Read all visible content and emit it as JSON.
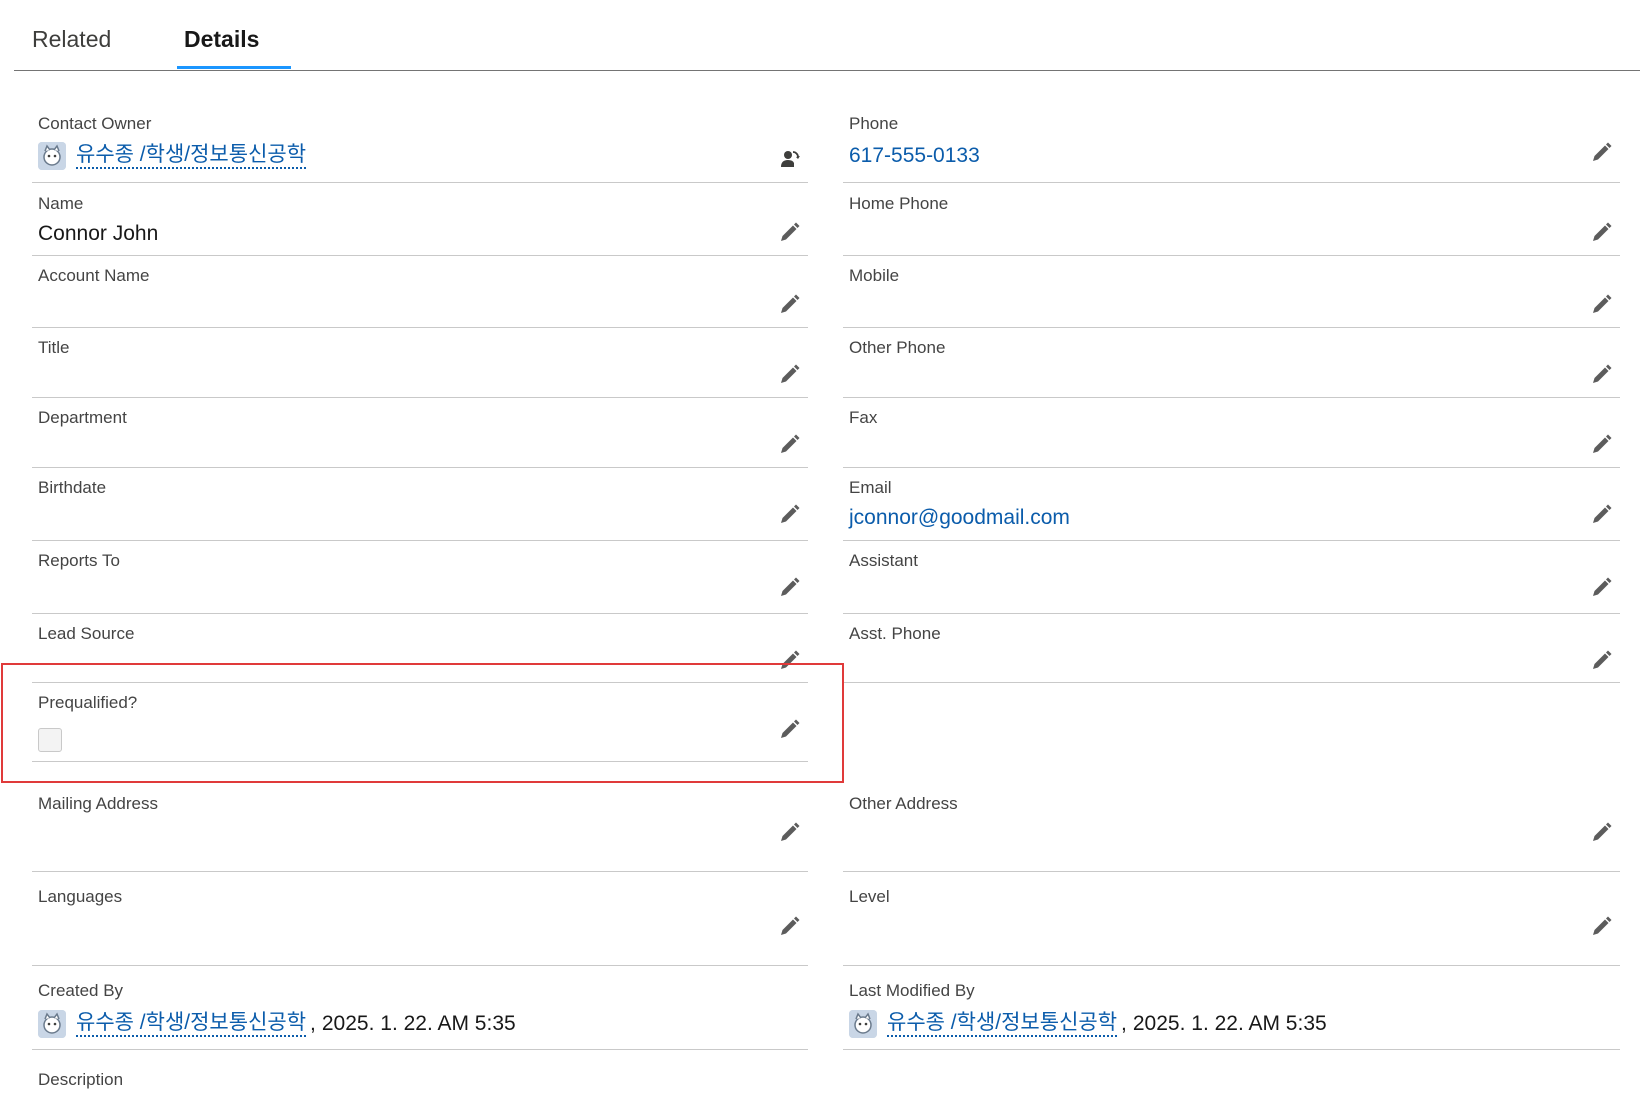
{
  "tabs": {
    "related": "Related",
    "details": "Details"
  },
  "owner": {
    "label": "Contact Owner",
    "name": "유수종 /학생/정보통신공학"
  },
  "left_fields": {
    "name": {
      "label": "Name",
      "value": "Connor John"
    },
    "account": {
      "label": "Account Name",
      "value": ""
    },
    "title": {
      "label": "Title",
      "value": ""
    },
    "department": {
      "label": "Department",
      "value": ""
    },
    "birthdate": {
      "label": "Birthdate",
      "value": ""
    },
    "reports_to": {
      "label": "Reports To",
      "value": ""
    },
    "lead_source": {
      "label": "Lead Source",
      "value": ""
    },
    "prequalified": {
      "label": "Prequalified?",
      "checked": false
    },
    "mailing_address": {
      "label": "Mailing Address",
      "value": ""
    },
    "languages": {
      "label": "Languages",
      "value": ""
    }
  },
  "right_fields": {
    "phone": {
      "label": "Phone",
      "value": "617-555-0133"
    },
    "home_phone": {
      "label": "Home Phone",
      "value": ""
    },
    "mobile": {
      "label": "Mobile",
      "value": ""
    },
    "other_phone": {
      "label": "Other Phone",
      "value": ""
    },
    "fax": {
      "label": "Fax",
      "value": ""
    },
    "email": {
      "label": "Email",
      "value": "jconnor@goodmail.com"
    },
    "assistant": {
      "label": "Assistant",
      "value": ""
    },
    "asst_phone": {
      "label": "Asst. Phone",
      "value": ""
    },
    "other_address": {
      "label": "Other Address",
      "value": ""
    },
    "level": {
      "label": "Level",
      "value": ""
    }
  },
  "created": {
    "label": "Created By",
    "name": "유수종 /학생/정보통신공학",
    "sep": ",",
    "date": "2025. 1. 22. AM 5:35"
  },
  "modified": {
    "label": "Last Modified By",
    "name": "유수종 /학생/정보통신공학",
    "sep": ",",
    "date": "2025. 1. 22. AM 5:35"
  },
  "description": {
    "label": "Description"
  },
  "colors": {
    "link": "#0b5cab",
    "tab_accent": "#1b96ff",
    "highlight": "#e03a3a"
  },
  "icons": {
    "edit": "pencil-icon",
    "change_owner": "change-owner-icon",
    "avatar": "user-avatar-icon"
  }
}
